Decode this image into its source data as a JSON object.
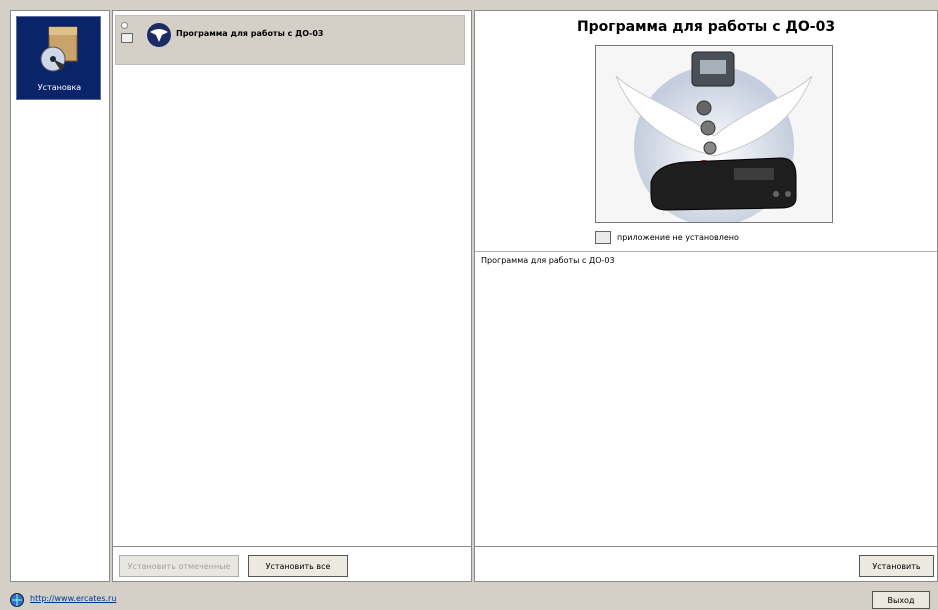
{
  "nav": {
    "items": [
      {
        "label": "Установка",
        "icon": "install-package-icon"
      }
    ]
  },
  "list": {
    "items": [
      {
        "label": "Программа для работы с ДО-03",
        "icon": "dove-app-icon",
        "selected": true
      }
    ],
    "buttons": {
      "install_selected": "Установить отмеченные",
      "install_all": "Установить все"
    }
  },
  "details": {
    "title": "Программа для работы с ДО-03",
    "status": "приложение не установлено",
    "description": "Программа для работы с ДО-03",
    "install_button": "Установить"
  },
  "footer": {
    "link": "http://www.ercates.ru",
    "exit_button": "Выход"
  }
}
